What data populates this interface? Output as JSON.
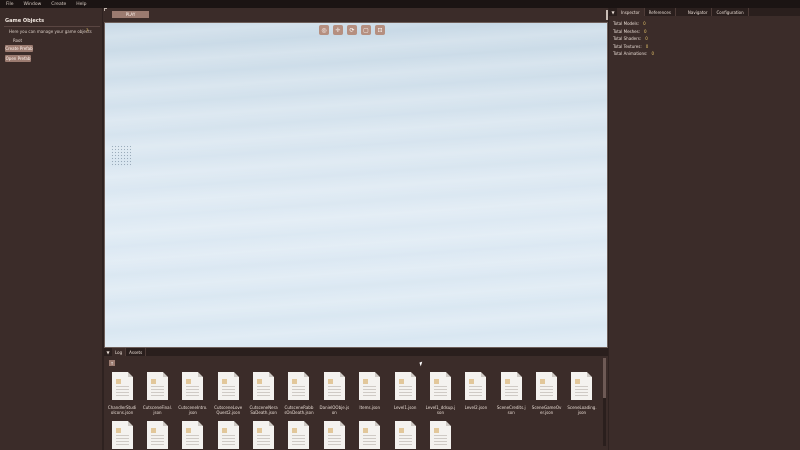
{
  "menu": [
    "File",
    "Window",
    "Create",
    "Help"
  ],
  "left_panel": {
    "title": "Game Objects",
    "hint": "Here you can manage your game objects",
    "hint_icon": "question-icon",
    "root": "Root",
    "create_prefab": "Create Prefab",
    "open_prefab": "Open Prefab"
  },
  "toolbar": {
    "play": "PLAY",
    "tools": [
      "select-icon",
      "move-icon",
      "rotate-icon",
      "scale-icon",
      "snap-icon"
    ]
  },
  "inspector": {
    "tabs": [
      "Inspector",
      "References",
      "Navigator",
      "Configuration"
    ],
    "stats": [
      {
        "label": "Total Models:",
        "value": "0"
      },
      {
        "label": "Total Meshes:",
        "value": "0"
      },
      {
        "label": "Total Shaders:",
        "value": "0"
      },
      {
        "label": "Total Textures:",
        "value": "0"
      },
      {
        "label": "Total Animations:",
        "value": "0"
      }
    ]
  },
  "bottom_panel": {
    "tabs": [
      "Log",
      "Assets"
    ],
    "files": [
      "ChandlerStudioIcons.json",
      "CutsceneFinal.json",
      "CutsceneIntro.json",
      "CutsceneLoveQuest2.json",
      "CutsceneNeraSaDeath.json",
      "CutsceneRabbsOnDeath.json",
      "DanielOObje.json",
      "Items.json",
      "Level1.json",
      "Level1_ddsup.json",
      "Level2.json",
      "SceneCredits.json",
      "SceneGameOver.json",
      "SceneLoading.json",
      "",
      "",
      "",
      "",
      "",
      "",
      "",
      "",
      "",
      ""
    ]
  },
  "colors": {
    "background": "#2e2220",
    "panel": "#3b2c29",
    "button": "#9b7b70",
    "accent": "#e6c46a"
  }
}
